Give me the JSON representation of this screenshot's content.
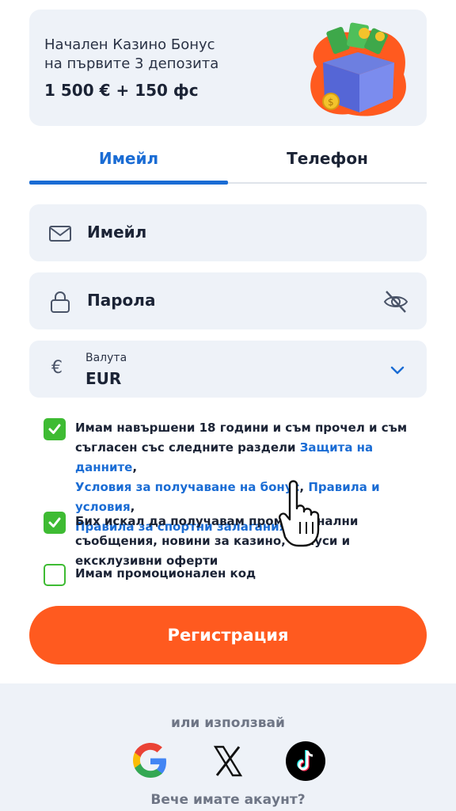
{
  "bonus": {
    "line1": "Начален Казино Бонус",
    "line2": "на първите 3 депозита",
    "amount": "1 500 € + 150 фс"
  },
  "tabs": [
    {
      "label": "Имейл",
      "active": true
    },
    {
      "label": "Телефон",
      "active": false
    }
  ],
  "form": {
    "email_placeholder": "Имейл",
    "password_placeholder": "Парола",
    "currency_label": "Валута",
    "currency_value": "EUR",
    "currency_symbol": "€"
  },
  "checks": {
    "terms_text": "Имам навършени 18 години и съм прочел и съм съгласен със следните раздели ",
    "terms_links": [
      "Защита на данните",
      "Условия за получаване на бонус",
      "Правила и условия",
      "Правила за спортни залагания"
    ],
    "terms_checked": true,
    "promo_text": "Бих искал да получавам промоционални съобщения, новини за казино, бонуси и ексклузивни оферти",
    "promo_checked": true,
    "code_text": "Имам промоционален код",
    "code_checked": false
  },
  "register_label": "Регистрация",
  "social": {
    "or_use": "или използвай",
    "providers": [
      "google-icon",
      "x-icon",
      "tiktok-icon"
    ],
    "have_account": "Вече имате акаунт?"
  },
  "colors": {
    "accent": "#1a6cd4",
    "button": "#ff5a1f",
    "check": "#3ebb33",
    "field_bg": "#eef2f8"
  }
}
